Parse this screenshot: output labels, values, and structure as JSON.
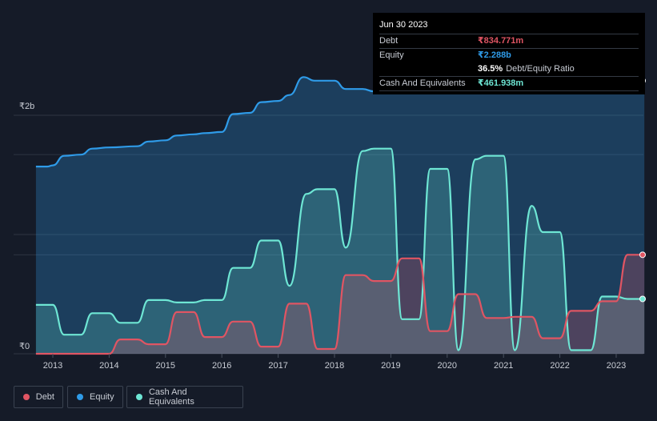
{
  "tooltip": {
    "date": "Jun 30 2023",
    "debt_label": "Debt",
    "debt_value": "₹834.771m",
    "equity_label": "Equity",
    "equity_value": "₹2.288b",
    "ratio_value": "36.5%",
    "ratio_label": "Debt/Equity Ratio",
    "cash_label": "Cash And Equivalents",
    "cash_value": "₹461.938m"
  },
  "colors": {
    "debt": "#e05563",
    "equity": "#2f9be8",
    "cash": "#6ee6d4",
    "background": "#151b28"
  },
  "legend": {
    "debt": "Debt",
    "equity": "Equity",
    "cash": "Cash And Equivalents"
  },
  "chart_data": {
    "type": "area",
    "y_tick_labels": [
      "₹2b",
      "₹0"
    ],
    "x_tick_labels": [
      "2013",
      "2014",
      "2015",
      "2016",
      "2017",
      "2018",
      "2019",
      "2020",
      "2021",
      "2022",
      "2023"
    ],
    "xlim": [
      2012.7,
      2023.5
    ],
    "ylim": [
      0,
      2.4
    ],
    "y_unit": "₹ billion",
    "grid": true,
    "legend_placement": "bottom-left",
    "series": [
      {
        "name": "Equity",
        "x": [
          2012.7,
          2012.9,
          2013.0,
          2013.2,
          2013.5,
          2013.7,
          2014.0,
          2014.5,
          2014.7,
          2015.0,
          2015.2,
          2015.5,
          2015.7,
          2016.0,
          2016.2,
          2016.5,
          2016.7,
          2017.0,
          2017.2,
          2017.45,
          2017.65,
          2018.0,
          2018.2,
          2018.5,
          2018.7,
          2019.0,
          2019.2,
          2019.5,
          2019.7,
          2020.0,
          2020.2,
          2020.5,
          2020.7,
          2021.0,
          2021.2,
          2021.5,
          2021.7,
          2022.0,
          2022.2,
          2022.55,
          2022.75,
          2023.0,
          2023.2,
          2023.5
        ],
        "values": [
          1.57,
          1.57,
          1.58,
          1.66,
          1.67,
          1.72,
          1.73,
          1.74,
          1.78,
          1.79,
          1.83,
          1.84,
          1.85,
          1.86,
          2.01,
          2.02,
          2.11,
          2.12,
          2.17,
          2.32,
          2.29,
          2.29,
          2.22,
          2.22,
          2.2,
          2.2,
          2.22,
          2.22,
          2.26,
          2.26,
          2.21,
          2.21,
          2.25,
          2.25,
          2.2,
          2.2,
          2.33,
          2.34,
          2.37,
          2.37,
          2.3,
          2.3,
          2.29,
          2.29
        ]
      },
      {
        "name": "Debt",
        "x": [
          2012.7,
          2013.0,
          2013.5,
          2014.0,
          2014.2,
          2014.5,
          2014.7,
          2015.0,
          2015.2,
          2015.5,
          2015.7,
          2016.0,
          2016.2,
          2016.5,
          2016.7,
          2017.0,
          2017.2,
          2017.5,
          2017.7,
          2018.0,
          2018.2,
          2018.5,
          2018.7,
          2019.0,
          2019.2,
          2019.5,
          2019.7,
          2020.0,
          2020.2,
          2020.5,
          2020.7,
          2021.0,
          2021.2,
          2021.5,
          2021.7,
          2022.0,
          2022.2,
          2022.55,
          2022.75,
          2023.0,
          2023.2,
          2023.5
        ],
        "values": [
          0,
          0,
          0,
          0,
          0.12,
          0.12,
          0.08,
          0.08,
          0.35,
          0.35,
          0.14,
          0.14,
          0.27,
          0.27,
          0.06,
          0.06,
          0.42,
          0.42,
          0.04,
          0.04,
          0.66,
          0.66,
          0.61,
          0.61,
          0.8,
          0.8,
          0.19,
          0.19,
          0.5,
          0.5,
          0.3,
          0.3,
          0.31,
          0.31,
          0.13,
          0.13,
          0.36,
          0.36,
          0.44,
          0.44,
          0.83,
          0.83
        ]
      },
      {
        "name": "Cash And Equivalents",
        "x": [
          2012.7,
          2013.0,
          2013.2,
          2013.5,
          2013.7,
          2014.0,
          2014.2,
          2014.5,
          2014.7,
          2015.0,
          2015.2,
          2015.5,
          2015.7,
          2016.0,
          2016.2,
          2016.5,
          2016.7,
          2017.0,
          2017.2,
          2017.5,
          2017.7,
          2018.0,
          2018.2,
          2018.5,
          2018.7,
          2019.0,
          2019.2,
          2019.5,
          2019.7,
          2020.0,
          2020.2,
          2020.5,
          2020.7,
          2021.0,
          2021.2,
          2021.5,
          2021.7,
          2022.0,
          2022.2,
          2022.55,
          2022.75,
          2023.0,
          2023.2,
          2023.5
        ],
        "values": [
          0.41,
          0.41,
          0.16,
          0.16,
          0.34,
          0.34,
          0.26,
          0.26,
          0.45,
          0.45,
          0.43,
          0.43,
          0.45,
          0.45,
          0.72,
          0.72,
          0.95,
          0.95,
          0.57,
          1.34,
          1.38,
          1.38,
          0.89,
          1.7,
          1.72,
          1.72,
          0.29,
          0.29,
          1.55,
          1.55,
          0.03,
          1.63,
          1.66,
          1.66,
          0.03,
          1.24,
          1.02,
          1.02,
          0.03,
          0.03,
          0.48,
          0.48,
          0.46,
          0.46
        ]
      }
    ]
  }
}
